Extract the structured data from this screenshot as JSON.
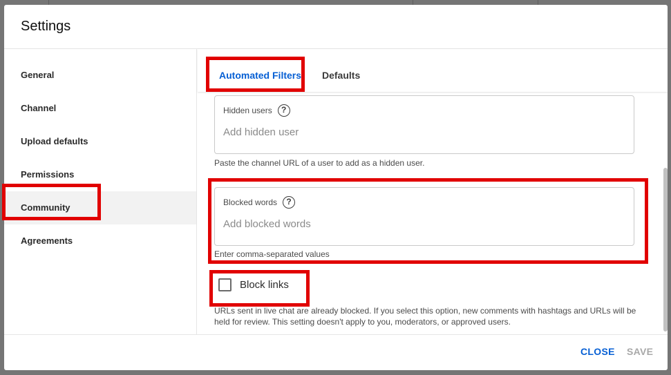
{
  "dialog": {
    "title": "Settings"
  },
  "sidebar": {
    "items": [
      {
        "label": "General"
      },
      {
        "label": "Channel"
      },
      {
        "label": "Upload defaults"
      },
      {
        "label": "Permissions"
      },
      {
        "label": "Community",
        "active": true
      },
      {
        "label": "Agreements"
      }
    ]
  },
  "tabs": [
    {
      "label": "Automated Filters",
      "active": true
    },
    {
      "label": "Defaults",
      "active": false
    }
  ],
  "hidden_users": {
    "label": "Hidden users",
    "placeholder": "Add hidden user",
    "hint": "Paste the channel URL of a user to add as a hidden user."
  },
  "blocked_words": {
    "label": "Blocked words",
    "placeholder": "Add blocked words",
    "hint": "Enter comma-separated values"
  },
  "block_links": {
    "label": "Block links",
    "checked": false,
    "note": "URLs sent in live chat are already blocked. If you select this option, new comments with hashtags and URLs will be held for review. This setting doesn't apply to you, moderators, or approved users."
  },
  "footer": {
    "close_label": "CLOSE",
    "save_label": "SAVE"
  },
  "colors": {
    "accent": "#065fd4",
    "highlight": "#e10000",
    "disabled": "#a8a8a8"
  },
  "icons": [
    "help-icon",
    "checkbox-icon"
  ]
}
